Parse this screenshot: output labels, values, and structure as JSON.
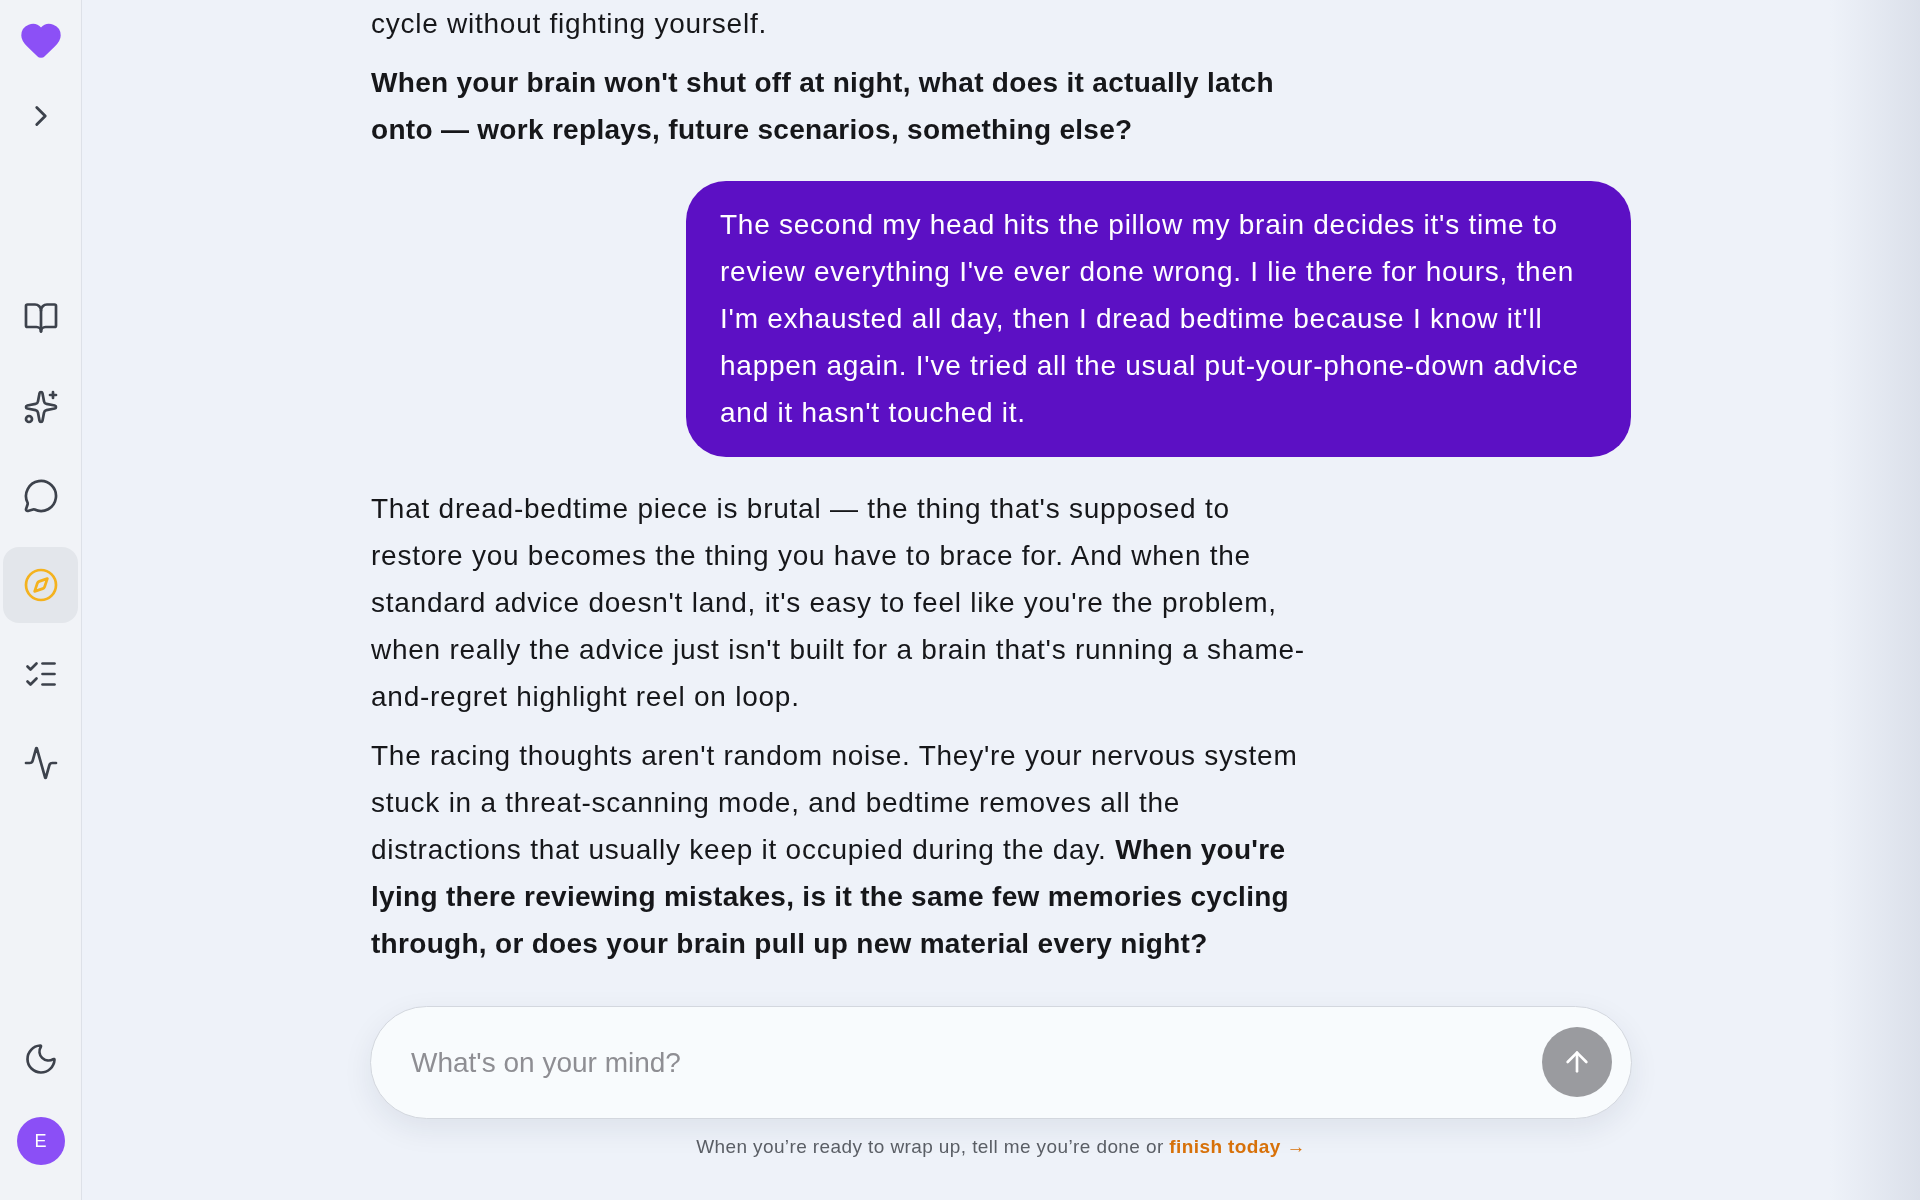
{
  "sidebar": {
    "nav_items": [
      {
        "kind": "book",
        "selected": false
      },
      {
        "kind": "sparkles",
        "selected": false
      },
      {
        "kind": "chat",
        "selected": false
      },
      {
        "kind": "compass",
        "selected": true
      },
      {
        "kind": "checklist",
        "selected": false
      },
      {
        "kind": "activity",
        "selected": false
      }
    ],
    "avatar": {
      "initial": "E"
    }
  },
  "conversation": [
    {
      "kind": "assistant",
      "paragraphs": [
        {
          "kind": "plain",
          "text": "cycle without fighting yourself."
        },
        {
          "kind": "question",
          "text": "When your brain won't shut off at night, what does it actually latch onto — work replays, future scenarios, something else?"
        }
      ]
    },
    {
      "kind": "user",
      "text": "The second my head hits the pillow my brain decides it's time to review everything I've ever done wrong. I lie there for hours, then I'm exhausted all day, then I dread bedtime because I know it'll happen again. I've tried all the usual put-your-phone-down advice and it hasn't touched it."
    },
    {
      "kind": "assistant",
      "paragraphs": [
        {
          "kind": "plain",
          "text": "That dread-bedtime piece is brutal — the thing that's supposed to restore you becomes the thing you have to brace for. And when the standard advice doesn't land, it's easy to feel like you're the problem, when really the advice just isn't built for a brain that's running a shame-and-regret highlight reel on loop."
        },
        {
          "kind": "plain",
          "text": "The racing thoughts aren't random noise. They're your nervous system stuck in a threat-scanning mode, and bedtime removes all the distractions that usually keep it occupied during the day. **When you're lying there reviewing mistakes, is it the same few memories cycling through, or does your brain pull up new material every night?**"
        }
      ]
    }
  ],
  "composer": {
    "placeholder": "What's on your mind?",
    "send_disabled": true
  },
  "footer": {
    "text": "When you’re ready to wrap up, tell me you’re done or",
    "link": "finish today →"
  }
}
